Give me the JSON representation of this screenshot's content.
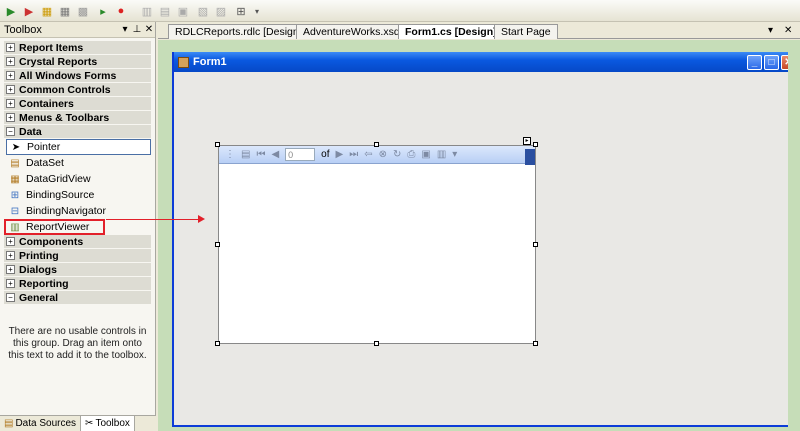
{
  "toolbox": {
    "title": "Toolbox",
    "categories_top": [
      "Report Items",
      "Crystal Reports",
      "All Windows Forms",
      "Common Controls",
      "Containers",
      "Menus & Toolbars"
    ],
    "open_category": "Data",
    "data_items": [
      "Pointer",
      "DataSet",
      "DataGridView",
      "BindingSource",
      "BindingNavigator",
      "ReportViewer"
    ],
    "categories_bottom": [
      "Components",
      "Printing",
      "Dialogs",
      "Reporting"
    ],
    "general_category": "General",
    "empty_message": "There are no usable controls in this group. Drag an item onto this text to add it to the toolbox.",
    "bottom_tabs": [
      "Data Sources",
      "Toolbox"
    ]
  },
  "doc_tabs": [
    {
      "label": "RDLCReports.rdlc [Design]"
    },
    {
      "label": "AdventureWorks.xsd*"
    },
    {
      "label": "Form1.cs [Design]*"
    },
    {
      "label": "Start Page"
    }
  ],
  "form": {
    "title": "Form1"
  },
  "report_viewer": {
    "page_value": "0",
    "of_label": "of"
  },
  "colors": {
    "annotation": "#e2202a",
    "form_title": "#0a59e0",
    "design_bg": "#c6ddb8"
  }
}
